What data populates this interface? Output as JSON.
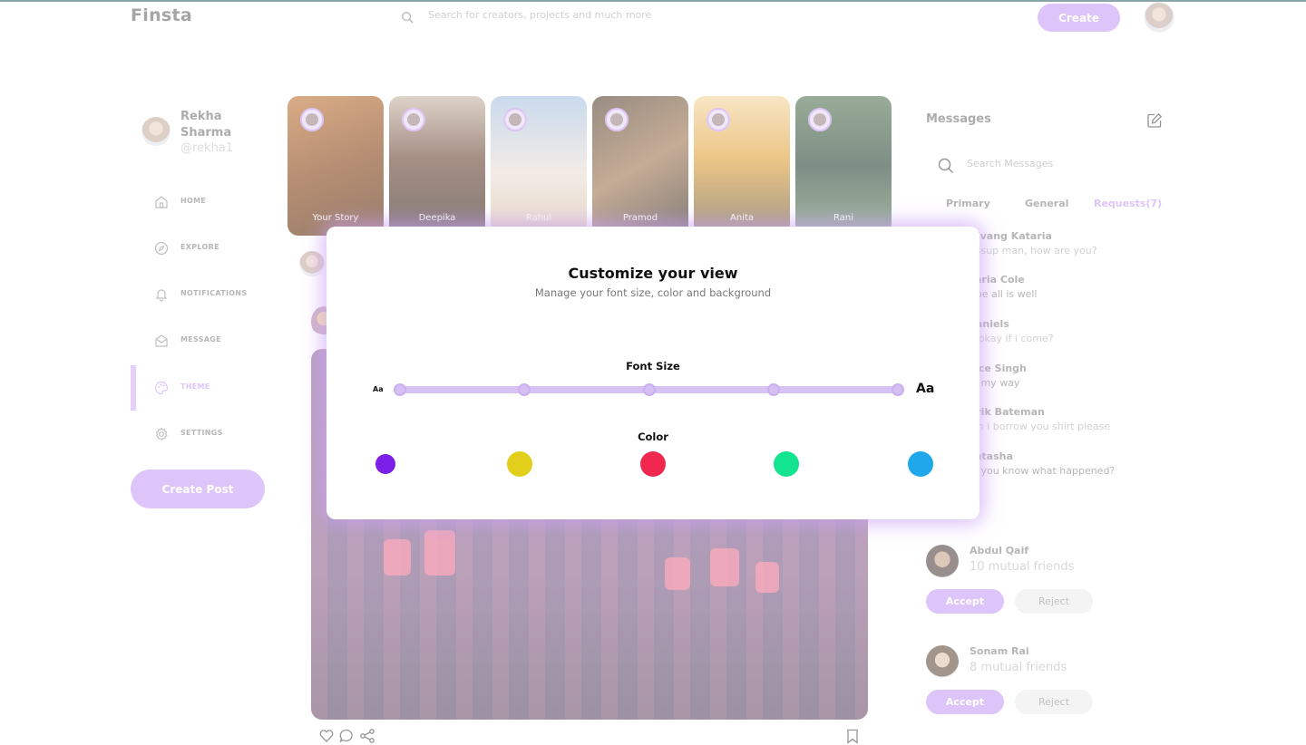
{
  "nav": {
    "logo": "Finsta",
    "search_placeholder": "Search for creators, projects and much more",
    "create_label": "Create"
  },
  "profile": {
    "name": "Rekha Sharma",
    "handle": "@rekha1"
  },
  "menu": [
    {
      "label": "HOME",
      "icon": "home-icon"
    },
    {
      "label": "EXPLORE",
      "icon": "compass-icon"
    },
    {
      "label": "NOTIFICATIONS",
      "icon": "bell-icon"
    },
    {
      "label": "MESSAGE",
      "icon": "mail-icon"
    },
    {
      "label": "THEME",
      "icon": "palette-icon",
      "active": true
    },
    {
      "label": "SETTINGS",
      "icon": "gear-icon"
    }
  ],
  "create_post_label": "Create Post",
  "stories": [
    {
      "name": "Your Story"
    },
    {
      "name": "Deepika"
    },
    {
      "name": "Rahul"
    },
    {
      "name": "Pramod"
    },
    {
      "name": "Anita"
    },
    {
      "name": "Rani"
    }
  ],
  "messages": {
    "title": "Messages",
    "search_placeholder": "Search Messages",
    "tabs": [
      "Primary",
      "General",
      "Requests(7)"
    ],
    "items": [
      {
        "name": "hivang Kataria",
        "text": "assup man, how are you?"
      },
      {
        "name": "aria Cole",
        "text": "ope all is well"
      },
      {
        "name": "aniels",
        "text": "t okay if i come?"
      },
      {
        "name": "nce Singh",
        "text": "n my way"
      },
      {
        "name": "trik Bateman",
        "text": "an i borrow you shirt please"
      },
      {
        "name": "atasha",
        "text": "d you know what happened?"
      }
    ]
  },
  "requests": [
    {
      "name": "Abdul Qaif",
      "mutual": "10 mutual friends",
      "accept": "Accept",
      "reject": "Reject"
    },
    {
      "name": "Sonam Rai",
      "mutual": "8 mutual friends",
      "accept": "Accept",
      "reject": "Reject"
    }
  ],
  "modal": {
    "title": "Customize your view",
    "subtitle": "Manage your font size, color and background",
    "font_size_label": "Font Size",
    "aa_small": "Aa",
    "aa_large": "Aa",
    "color_label": "Color",
    "colors": [
      "#7b1fe8",
      "#e2cf1c",
      "#f0284f",
      "#12e48f",
      "#1ea7ea"
    ]
  },
  "colors": {
    "accent": "#c9a0f5"
  }
}
